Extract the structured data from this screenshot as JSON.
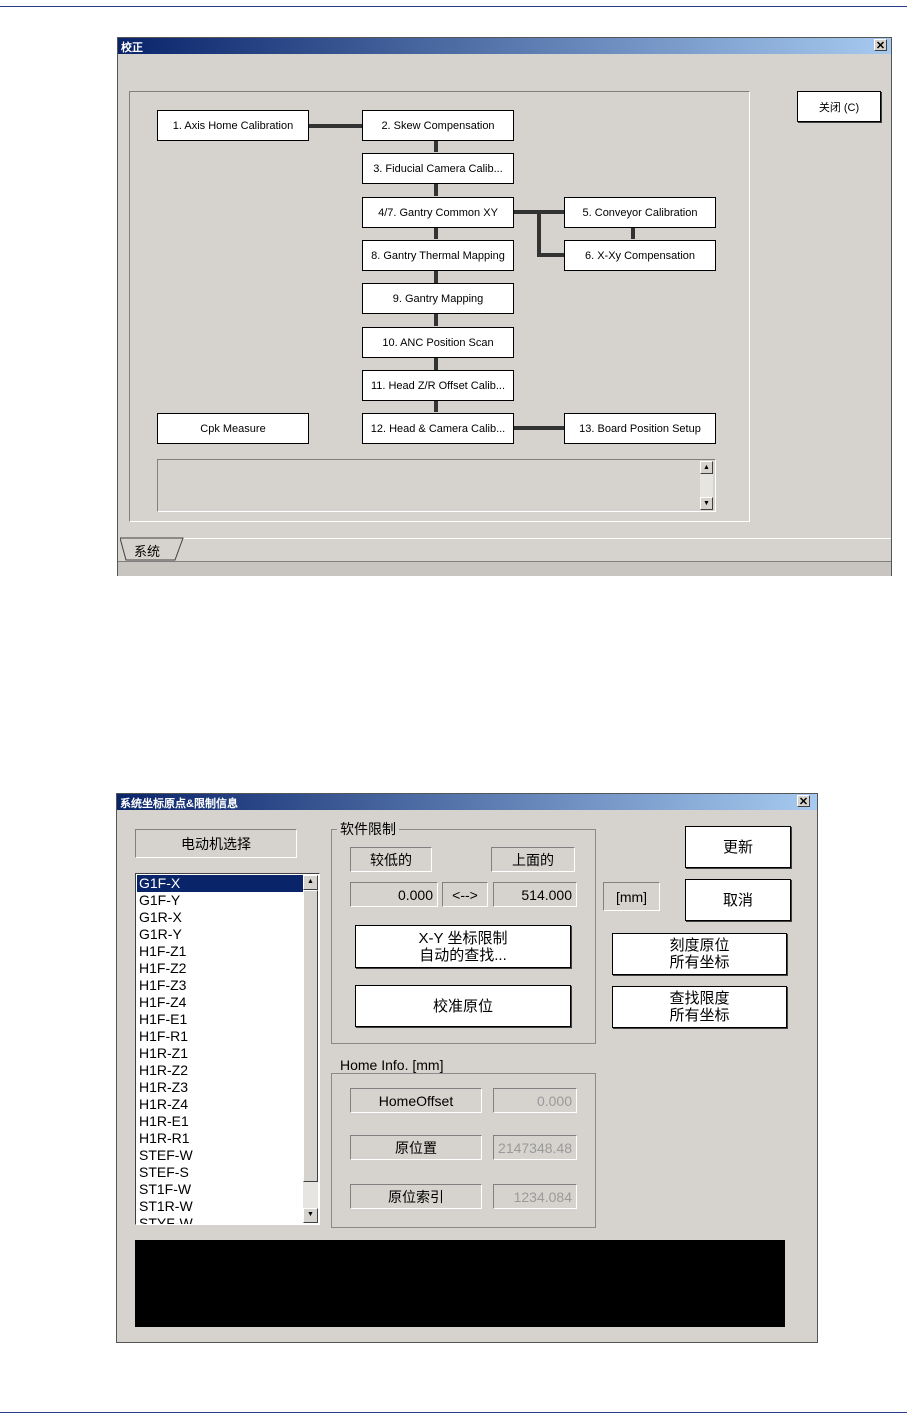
{
  "calib_window": {
    "title": "校正",
    "close_button": "关闭 (C)",
    "tab": "系统",
    "steps": {
      "s1": "1. Axis Home Calibration",
      "s2": "2. Skew Compensation",
      "s3": "3. Fiducial Camera Calib...",
      "s47": "4/7. Gantry Common XY",
      "s5": "5. Conveyor Calibration",
      "s6": "6. X-Xy Compensation",
      "s8": "8. Gantry Thermal Mapping",
      "s9": "9. Gantry Mapping",
      "s10": "10. ANC Position Scan",
      "s11": "11. Head Z/R Offset Calib...",
      "cpk": "Cpk Measure",
      "s12": "12. Head & Camera Calib...",
      "s13": "13. Board Position Setup"
    }
  },
  "home_window": {
    "title": "系统坐标原点&限制信息",
    "motor_select_label": "电动机选择",
    "motors": [
      "G1F-X",
      "G1F-Y",
      "G1R-X",
      "G1R-Y",
      "H1F-Z1",
      "H1F-Z2",
      "H1F-Z3",
      "H1F-Z4",
      "H1F-E1",
      "H1F-R1",
      "H1R-Z1",
      "H1R-Z2",
      "H1R-Z3",
      "H1R-Z4",
      "H1R-E1",
      "H1R-R1",
      "STEF-W",
      "STEF-S",
      "ST1F-W",
      "ST1R-W",
      "STYF-W"
    ],
    "selected_motor": "G1F-X",
    "soft_limit": {
      "group_title": "软件限制",
      "lower_label": "较低的",
      "upper_label": "上面的",
      "lower_value": "0.000",
      "arrow": "<-->",
      "upper_value": "514.000",
      "xy_find_line1": "X-Y 坐标限制",
      "xy_find_line2": "自动的查找...",
      "calib_home": "校准原位"
    },
    "unit": "[mm]",
    "update_button": "更新",
    "cancel_button": "取消",
    "scale_home_line1": "刻度原位",
    "scale_home_line2": "所有坐标",
    "find_limit_line1": "查找限度",
    "find_limit_line2": "所有坐标",
    "home_info": {
      "group_title": "Home Info. [mm]",
      "offset_label": "HomeOffset",
      "offset_value": "0.000",
      "position_label": "原位置",
      "position_value": "2147348.48",
      "index_label": "原位索引",
      "index_value": "1234.084"
    }
  }
}
